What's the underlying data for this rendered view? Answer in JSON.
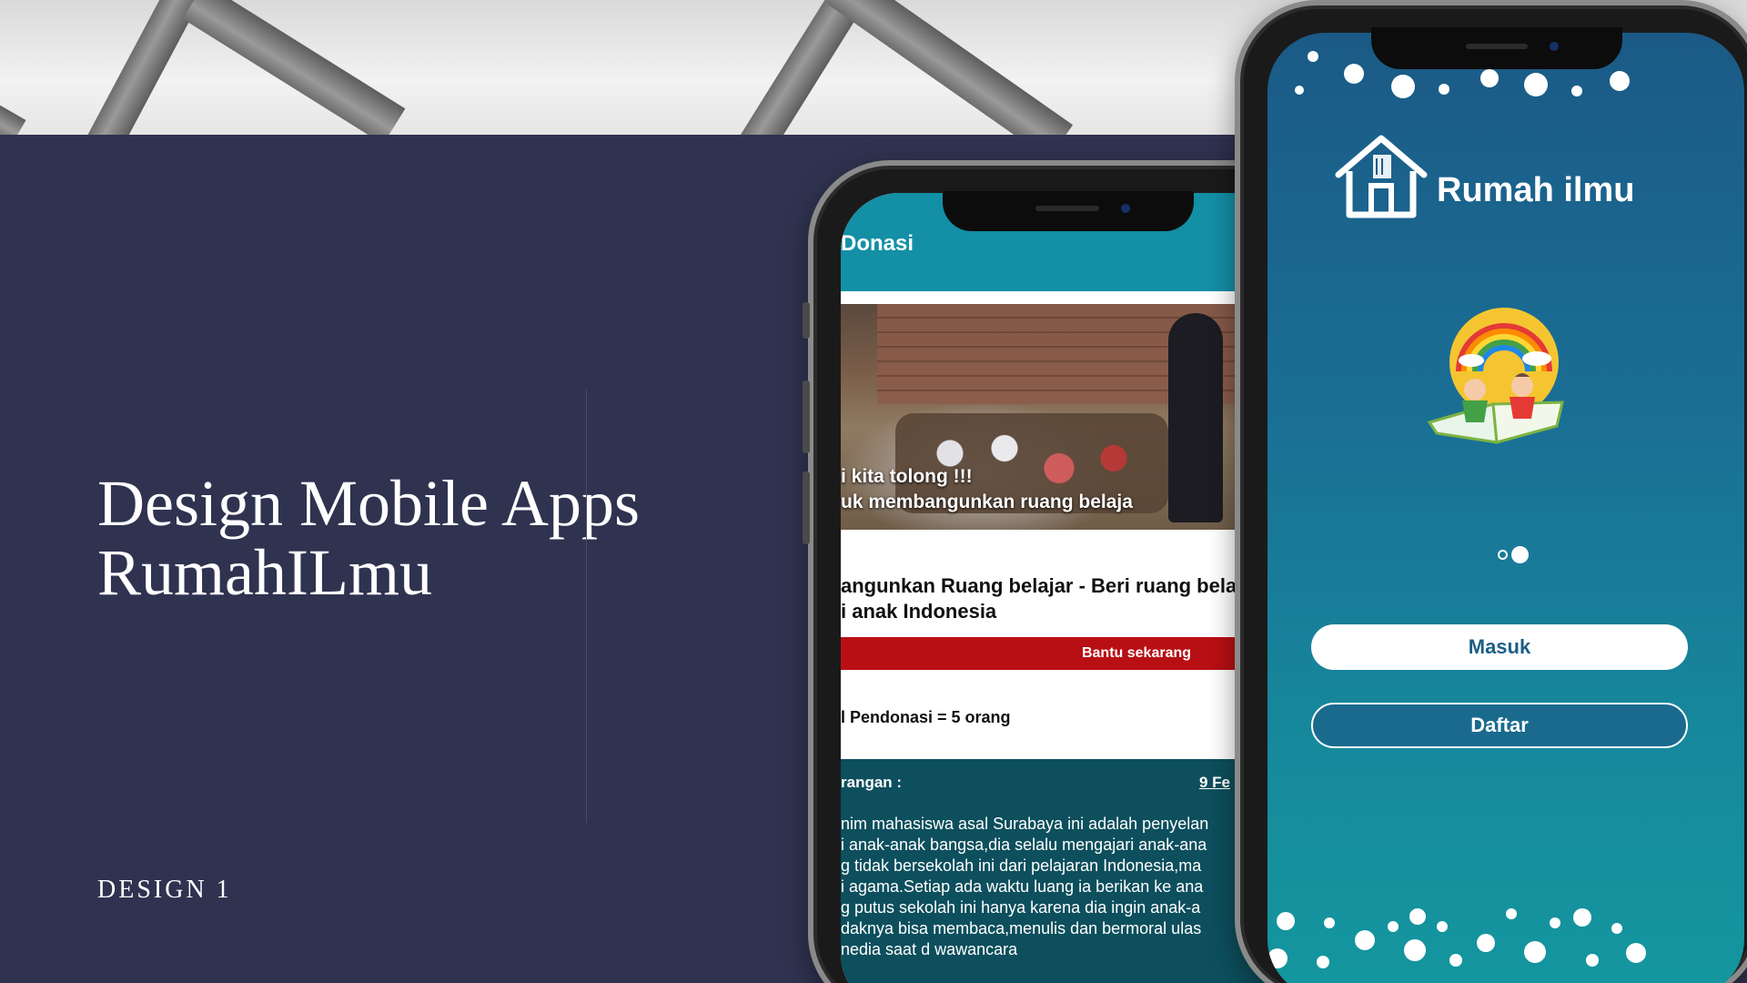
{
  "slide": {
    "title_line1": "Design Mobile Apps",
    "title_line2": "RumahILmu",
    "subtitle": "DESIGN 1"
  },
  "donation_screen": {
    "header_title": "Donasi",
    "caption_line1": "i kita tolong !!!",
    "caption_line2": "uk membangunkan ruang belaja",
    "heart_icon": "heart",
    "card_title_line1": "angunkan Ruang belajar - Beri ruang belaja",
    "card_title_line2": "i anak Indonesia",
    "help_button": "Bantu sekarang",
    "donors": "l Pendonasi = 5 orang",
    "info_label": "rangan :",
    "info_date": "9 Fe",
    "info_body": [
      "nim mahasiswa asal Surabaya ini adalah penyelan",
      "i anak-anak bangsa,dia selalu mengajari anak-ana",
      "g tidak bersekolah ini dari pelajaran Indonesia,ma",
      "i agama.Setiap ada waktu luang ia berikan ke ana",
      "g putus sekolah ini hanya karena dia ingin anak-a",
      "daknya bisa membaca,menulis dan bermoral ulas",
      "nedia saat d wawancara"
    ],
    "colors": {
      "header": "#138fa6",
      "help_button": "#b80f14",
      "info_bg": "#0d4f5d"
    }
  },
  "splash_screen": {
    "app_name": "Rumah ilmu",
    "login_button": "Masuk",
    "register_button": "Daftar",
    "logo_icon": "house-book-icon",
    "illustration_icon": "children-rainbow-book-icon",
    "colors": {
      "gradient_top": "#1b5a86",
      "gradient_bottom": "#14979f",
      "login_text": "#1c5f86"
    }
  }
}
